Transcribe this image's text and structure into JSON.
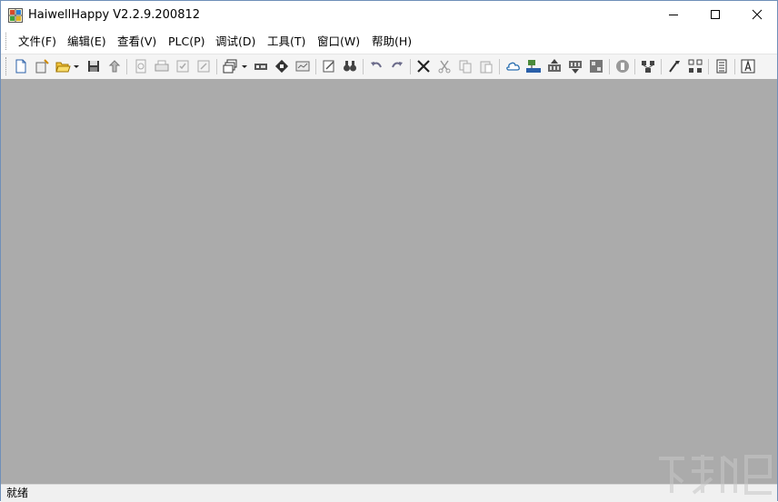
{
  "window": {
    "title": "HaiwellHappy V2.2.9.200812",
    "icons": {
      "app": "app-grid-icon",
      "minimize": "minimize-icon",
      "maximize": "maximize-icon",
      "close": "close-icon"
    }
  },
  "menubar": {
    "items": [
      {
        "label": "文件(F)"
      },
      {
        "label": "编辑(E)"
      },
      {
        "label": "查看(V)"
      },
      {
        "label": "PLC(P)"
      },
      {
        "label": "调试(D)"
      },
      {
        "label": "工具(T)"
      },
      {
        "label": "窗口(W)"
      },
      {
        "label": "帮助(H)"
      }
    ]
  },
  "toolbar": {
    "buttons": [
      {
        "name": "new-file-icon",
        "enabled": true
      },
      {
        "name": "new-project-icon",
        "enabled": true
      },
      {
        "name": "open-folder-icon",
        "enabled": true
      },
      {
        "name": "save-icon",
        "enabled": true
      },
      {
        "name": "upload-icon",
        "enabled": true
      },
      {
        "name": "print-preview-icon",
        "enabled": false
      },
      {
        "name": "print-icon",
        "enabled": false
      },
      {
        "name": "check-icon",
        "enabled": false
      },
      {
        "name": "compile-icon",
        "enabled": false
      },
      {
        "name": "windows-icon",
        "enabled": true
      },
      {
        "name": "module-icon",
        "enabled": true
      },
      {
        "name": "chip-icon",
        "enabled": true
      },
      {
        "name": "monitor-icon",
        "enabled": true
      },
      {
        "name": "edit-sheet-icon",
        "enabled": true
      },
      {
        "name": "find-icon",
        "enabled": true
      },
      {
        "name": "undo-icon",
        "enabled": true
      },
      {
        "name": "redo-icon",
        "enabled": true
      },
      {
        "name": "delete-icon",
        "enabled": true
      },
      {
        "name": "cut-icon",
        "enabled": false
      },
      {
        "name": "copy-icon",
        "enabled": false
      },
      {
        "name": "paste-icon",
        "enabled": false
      },
      {
        "name": "cloud-icon",
        "enabled": true
      },
      {
        "name": "network-icon",
        "enabled": true
      },
      {
        "name": "plc-upload-icon",
        "enabled": true
      },
      {
        "name": "plc-download-icon",
        "enabled": true
      },
      {
        "name": "plc-compare-icon",
        "enabled": true
      },
      {
        "name": "run-stop-icon",
        "enabled": true
      },
      {
        "name": "diagnose-icon",
        "enabled": true
      },
      {
        "name": "tool-icon",
        "enabled": true
      },
      {
        "name": "simulate-icon",
        "enabled": true
      },
      {
        "name": "memory-icon",
        "enabled": true
      },
      {
        "name": "font-icon",
        "enabled": true
      }
    ],
    "overflow_icon": "toolbar-overflow-icon"
  },
  "statusbar": {
    "text": "就绪"
  },
  "colors": {
    "client_background": "#ababab",
    "toolbar_background": "#f4f4f4",
    "statusbar_background": "#f0f0f0"
  }
}
